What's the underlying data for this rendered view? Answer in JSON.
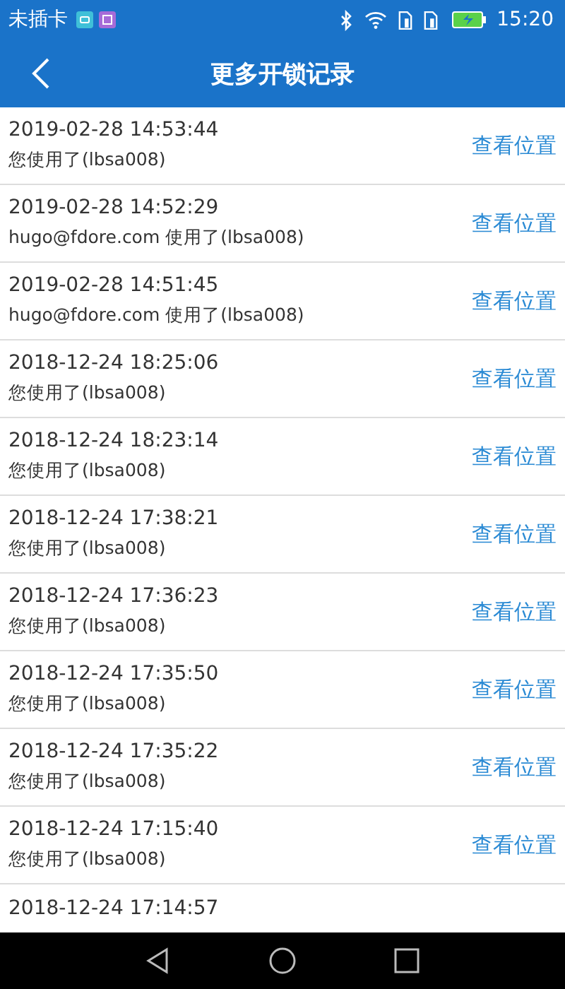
{
  "status_bar": {
    "carrier": "未插卡",
    "time": "15:20"
  },
  "header": {
    "title": "更多开锁记录"
  },
  "records": [
    {
      "time": "2019-02-28 14:53:44",
      "detail": "您使用了(lbsa008)",
      "action": "查看位置"
    },
    {
      "time": "2019-02-28 14:52:29",
      "detail": "hugo@fdore.com 使用了(lbsa008)",
      "action": "查看位置"
    },
    {
      "time": "2019-02-28 14:51:45",
      "detail": "hugo@fdore.com 使用了(lbsa008)",
      "action": "查看位置"
    },
    {
      "time": "2018-12-24 18:25:06",
      "detail": "您使用了(lbsa008)",
      "action": "查看位置"
    },
    {
      "time": "2018-12-24 18:23:14",
      "detail": "您使用了(lbsa008)",
      "action": "查看位置"
    },
    {
      "time": "2018-12-24 17:38:21",
      "detail": "您使用了(lbsa008)",
      "action": "查看位置"
    },
    {
      "time": "2018-12-24 17:36:23",
      "detail": "您使用了(lbsa008)",
      "action": "查看位置"
    },
    {
      "time": "2018-12-24 17:35:50",
      "detail": "您使用了(lbsa008)",
      "action": "查看位置"
    },
    {
      "time": "2018-12-24 17:35:22",
      "detail": "您使用了(lbsa008)",
      "action": "查看位置"
    },
    {
      "time": "2018-12-24 17:15:40",
      "detail": "您使用了(lbsa008)",
      "action": "查看位置"
    },
    {
      "time": "2018-12-24 17:14:57"
    }
  ]
}
